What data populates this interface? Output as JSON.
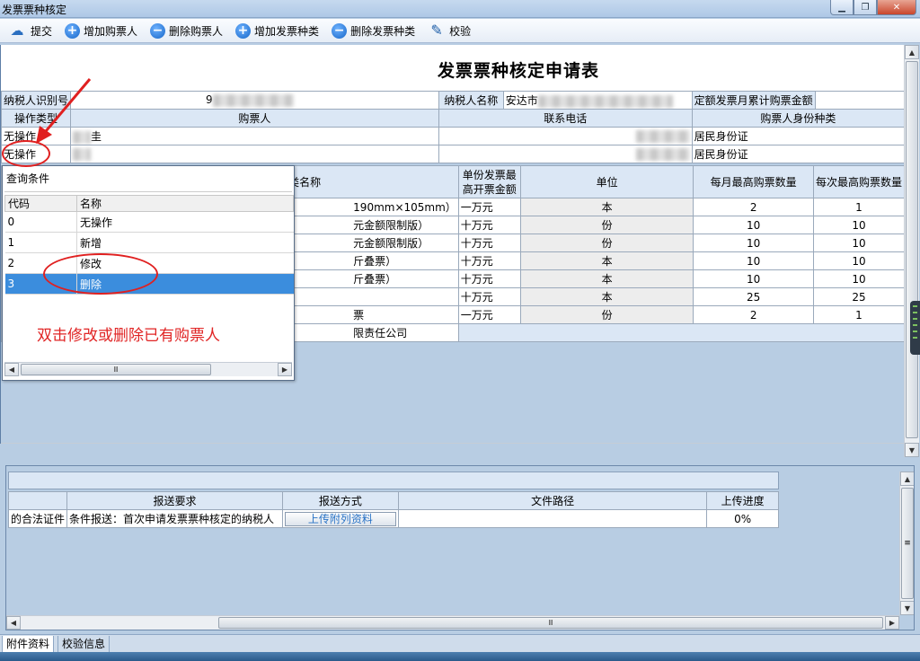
{
  "window": {
    "title": "发票票种核定",
    "controls": {
      "minimize": "▁",
      "restore": "❐",
      "close": "✕"
    }
  },
  "toolbar": {
    "submit": "提交",
    "add_buyer": "增加购票人",
    "delete_buyer": "删除购票人",
    "add_invoice_type": "增加发票种类",
    "delete_invoice_type": "删除发票种类",
    "verify": "校验",
    "icons": {
      "submit": "cloud-upload-icon",
      "add": "plus-circle-icon",
      "remove": "minus-circle-icon",
      "verify": "edit-icon"
    }
  },
  "form": {
    "title": "发票票种核定申请表",
    "taxpayer_id_label": "纳税人识别号",
    "taxpayer_id_value": "9",
    "taxpayer_name_label": "纳税人名称",
    "taxpayer_name_value": "安达市",
    "quota_label": "定额发票月累计购票金额",
    "buyer_headers": {
      "op_type": "操作类型",
      "buyer": "购票人",
      "phone": "联系电话",
      "id_type": "购票人身份种类"
    },
    "buyers": [
      {
        "op": "无操作",
        "name_suffix": "圭",
        "id_type": "居民身份证"
      },
      {
        "op": "无操作",
        "name_suffix": "",
        "id_type": "居民身份证"
      }
    ],
    "invoice_headers": {
      "type_name": "类名称",
      "max_amount": "单份发票最高开票金额",
      "unit": "单位",
      "monthly_max": "每月最高购票数量",
      "per_max": "每次最高购票数量"
    },
    "invoices": [
      {
        "name": "190mm×105mm）",
        "max_amount": "一万元",
        "unit": "本",
        "monthly": "2",
        "per": "1"
      },
      {
        "name": "元金额限制版）",
        "max_amount": "十万元",
        "unit": "份",
        "monthly": "10",
        "per": "10"
      },
      {
        "name": "元金额限制版）",
        "max_amount": "十万元",
        "unit": "份",
        "monthly": "10",
        "per": "10"
      },
      {
        "name": "斤叠票）",
        "max_amount": "十万元",
        "unit": "本",
        "monthly": "10",
        "per": "10"
      },
      {
        "name": "斤叠票）",
        "max_amount": "十万元",
        "unit": "本",
        "monthly": "10",
        "per": "10"
      },
      {
        "name": "",
        "max_amount": "十万元",
        "unit": "本",
        "monthly": "25",
        "per": "25"
      },
      {
        "name": "票",
        "max_amount": "一万元",
        "unit": "份",
        "monthly": "2",
        "per": "1"
      }
    ],
    "company_suffix": "限责任公司"
  },
  "dropdown": {
    "query_label": "查询条件",
    "col_code": "代码",
    "col_name": "名称",
    "options": [
      {
        "code": "0",
        "name": "无操作"
      },
      {
        "code": "1",
        "name": "新增"
      },
      {
        "code": "2",
        "name": "修改"
      },
      {
        "code": "3",
        "name": "删除"
      }
    ],
    "selected_index": 3,
    "current_value": "无操作"
  },
  "annotation": {
    "text": "双击修改或删除已有购票人",
    "color": "#e02424"
  },
  "attachments": {
    "headers": {
      "requirement": "报送要求",
      "method": "报送方式",
      "path": "文件路径",
      "progress": "上传进度"
    },
    "rows": [
      {
        "name_suffix": "的合法证件",
        "requirement": "条件报送：首次申请发票票种核定的纳税人",
        "upload_label": "上传附列资料",
        "path": "",
        "progress": "0%"
      }
    ]
  },
  "tabs": [
    {
      "label": "附件资料",
      "active": true
    },
    {
      "label": "校验信息",
      "active": false
    }
  ],
  "scroll": {
    "grip": "Ⅲ",
    "up": "▲",
    "down": "▼",
    "left": "◀",
    "right": "▶",
    "h_mid": "Ⅲ",
    "v_mid": "≡"
  }
}
